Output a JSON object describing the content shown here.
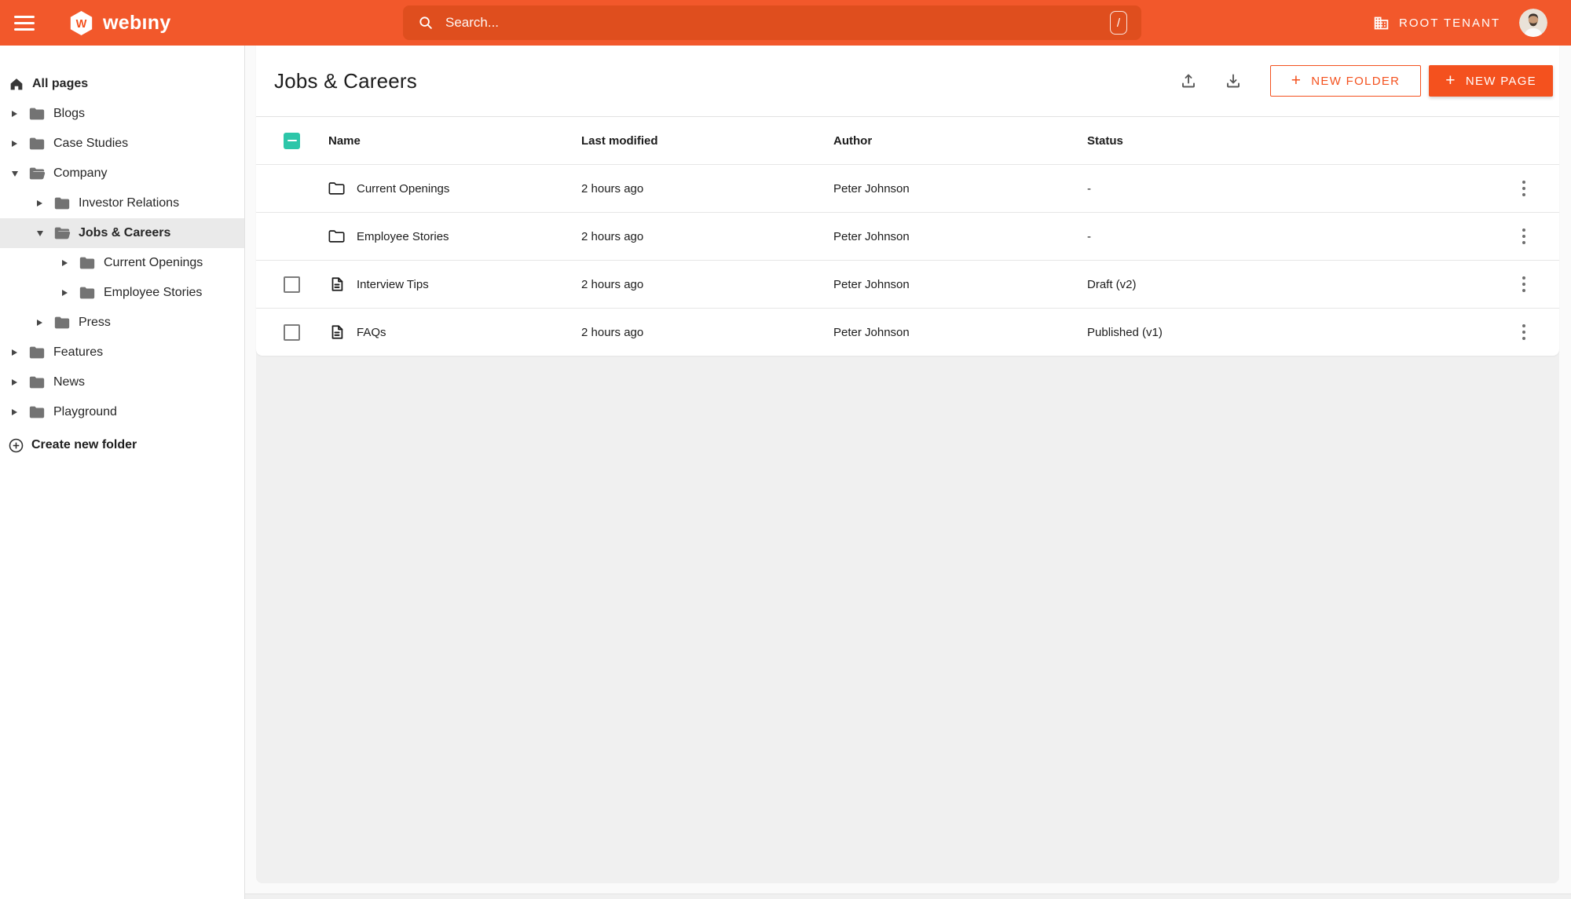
{
  "topbar": {
    "brand": "webıny",
    "search": {
      "placeholder": "Search...",
      "shortcut": "/"
    },
    "tenant": "ROOT TENANT"
  },
  "sidebar": {
    "root": "All pages",
    "create_label": "Create new folder",
    "items": [
      {
        "label": "Blogs",
        "level": 0,
        "state": "collapsed",
        "selected": false
      },
      {
        "label": "Case Studies",
        "level": 0,
        "state": "collapsed",
        "selected": false
      },
      {
        "label": "Company",
        "level": 0,
        "state": "expanded",
        "selected": false
      },
      {
        "label": "Investor Relations",
        "level": 1,
        "state": "collapsed",
        "selected": false
      },
      {
        "label": "Jobs & Careers",
        "level": 1,
        "state": "expanded",
        "selected": true
      },
      {
        "label": "Current Openings",
        "level": 2,
        "state": "collapsed",
        "selected": false
      },
      {
        "label": "Employee Stories",
        "level": 2,
        "state": "collapsed",
        "selected": false
      },
      {
        "label": "Press",
        "level": 1,
        "state": "collapsed",
        "selected": false
      },
      {
        "label": "Features",
        "level": 0,
        "state": "collapsed",
        "selected": false
      },
      {
        "label": "News",
        "level": 0,
        "state": "collapsed",
        "selected": false
      },
      {
        "label": "Playground",
        "level": 0,
        "state": "collapsed",
        "selected": false
      }
    ]
  },
  "main": {
    "title": "Jobs & Careers",
    "buttons": {
      "new_folder": "NEW FOLDER",
      "new_page": "NEW PAGE"
    },
    "table": {
      "headers": {
        "name": "Name",
        "modified": "Last modified",
        "author": "Author",
        "status": "Status"
      },
      "rows": [
        {
          "type": "folder",
          "name": "Current Openings",
          "modified": "2 hours ago",
          "author": "Peter Johnson",
          "status": "-",
          "checkbox": false
        },
        {
          "type": "folder",
          "name": "Employee Stories",
          "modified": "2 hours ago",
          "author": "Peter Johnson",
          "status": "-",
          "checkbox": false
        },
        {
          "type": "page",
          "name": "Interview Tips",
          "modified": "2 hours ago",
          "author": "Peter Johnson",
          "status": "Draft (v2)",
          "checkbox": true
        },
        {
          "type": "page",
          "name": "FAQs",
          "modified": "2 hours ago",
          "author": "Peter Johnson",
          "status": "Published (v1)",
          "checkbox": true
        }
      ]
    }
  },
  "colors": {
    "primary": "#F4511E",
    "topbar": "#F2582B",
    "search": "#DF4E1E",
    "teal": "#2DC6A9"
  }
}
